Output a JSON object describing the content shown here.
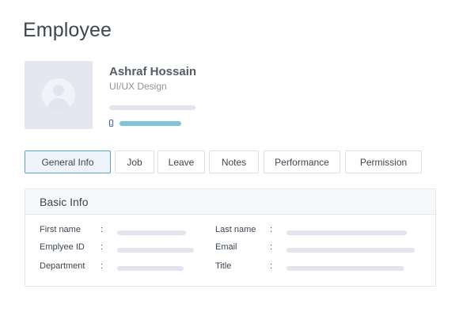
{
  "page_title": "Employee",
  "profile": {
    "name": "Ashraf Hossain",
    "department": "UI/UX Design"
  },
  "colors": {
    "accent_bar": "#7cc5da",
    "phone_icon": "#4763d4",
    "placeholder": "#e2e4ef",
    "active_tab_border": "#5ba4c8"
  },
  "tabs": [
    {
      "label": "General Info",
      "active": true
    },
    {
      "label": "Job",
      "active": false
    },
    {
      "label": "Leave",
      "active": false
    },
    {
      "label": "Notes",
      "active": false
    },
    {
      "label": "Performance",
      "active": false
    },
    {
      "label": "Permission",
      "active": false
    }
  ],
  "basic_info": {
    "title": "Basic Info",
    "separator": ":",
    "fields": [
      {
        "label": "First name"
      },
      {
        "label": "Last name"
      },
      {
        "label": "Emplyee ID"
      },
      {
        "label": "Email"
      },
      {
        "label": "Department"
      },
      {
        "label": "Title"
      }
    ]
  },
  "icons": {
    "avatar": "user-avatar-icon",
    "phone": "phone-icon"
  }
}
